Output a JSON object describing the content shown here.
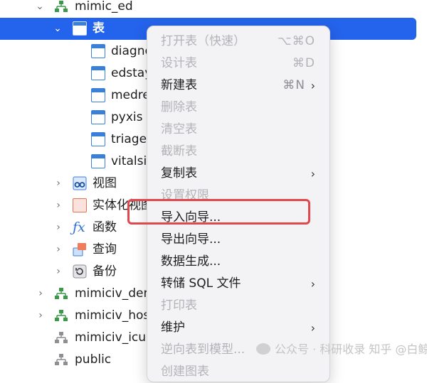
{
  "tree": {
    "db_top": "mimic_ed",
    "table_group": "表",
    "tables": [
      "diagno",
      "edstay",
      "medre",
      "pyxis",
      "triage",
      "vitalsig"
    ],
    "groups": [
      "视图",
      "实体化视图",
      "函数",
      "查询",
      "备份"
    ],
    "dbs_bottom": [
      "mimiciv_deri",
      "mimiciv_hosp",
      "mimiciv_icu",
      "public"
    ]
  },
  "menu": {
    "items": [
      {
        "label": "打开表（快速）",
        "shortcut": "⌥⌘O",
        "disabled": true,
        "submenu": false
      },
      {
        "label": "设计表",
        "shortcut": "⌘D",
        "disabled": true,
        "submenu": false
      },
      {
        "label": "新建表",
        "shortcut": "⌘N",
        "disabled": false,
        "submenu": true
      },
      {
        "label": "删除表",
        "shortcut": "",
        "disabled": true,
        "submenu": false
      },
      {
        "label": "清空表",
        "shortcut": "",
        "disabled": true,
        "submenu": false
      },
      {
        "label": "截断表",
        "shortcut": "",
        "disabled": true,
        "submenu": false
      },
      {
        "label": "复制表",
        "shortcut": "",
        "disabled": false,
        "submenu": true
      },
      {
        "label": "设置权限",
        "shortcut": "",
        "disabled": true,
        "submenu": false
      },
      {
        "label": "导入向导...",
        "shortcut": "",
        "disabled": false,
        "submenu": false
      },
      {
        "label": "导出向导...",
        "shortcut": "",
        "disabled": false,
        "submenu": false
      },
      {
        "label": "数据生成...",
        "shortcut": "",
        "disabled": false,
        "submenu": false
      },
      {
        "label": "转储 SQL 文件",
        "shortcut": "",
        "disabled": false,
        "submenu": true
      },
      {
        "label": "打印表",
        "shortcut": "",
        "disabled": true,
        "submenu": false
      },
      {
        "label": "维护",
        "shortcut": "",
        "disabled": false,
        "submenu": true
      },
      {
        "label": "逆向表到模型...",
        "shortcut": "",
        "disabled": true,
        "submenu": false
      },
      {
        "label": "创建图表",
        "shortcut": "",
        "disabled": true,
        "submenu": false
      }
    ]
  },
  "watermark": "公众号 · 科研收录   知乎 @白鲸鱼",
  "colors": {
    "selection": "#2463eb",
    "highlight_box": "#e0484d"
  }
}
